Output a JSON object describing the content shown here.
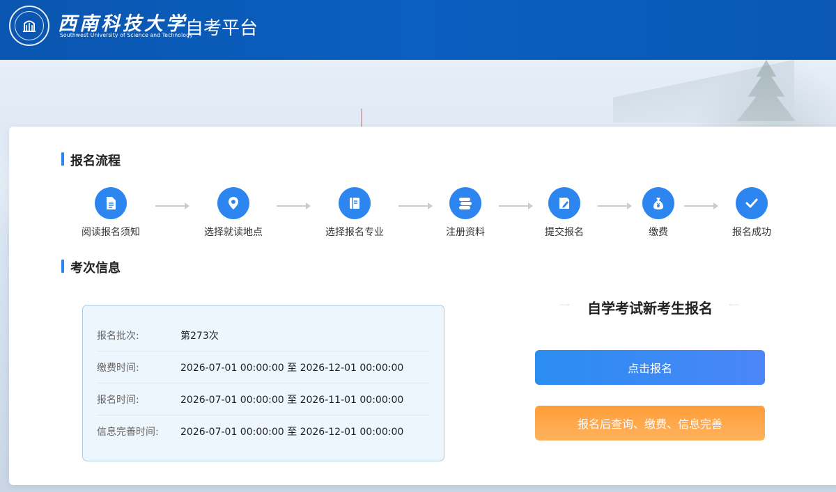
{
  "header": {
    "logo_cn": "西南科技大学",
    "logo_en": "Southwest University of Science and Technology",
    "platform_title": "自考平台"
  },
  "process": {
    "title": "报名流程",
    "steps": [
      {
        "label": "阅读报名须知",
        "icon": "document-icon"
      },
      {
        "label": "选择就读地点",
        "icon": "location-pin-icon"
      },
      {
        "label": "选择报名专业",
        "icon": "book-icon"
      },
      {
        "label": "注册资料",
        "icon": "register-stack-icon"
      },
      {
        "label": "提交报名",
        "icon": "edit-form-icon"
      },
      {
        "label": "缴费",
        "icon": "money-bag-icon"
      },
      {
        "label": "报名成功",
        "icon": "checkmark-icon"
      }
    ]
  },
  "exam_info": {
    "title": "考次信息",
    "rows": [
      {
        "key": "报名批次:",
        "value": "第273次"
      },
      {
        "key": "缴费时间:",
        "value": "2026-07-01 00:00:00 至 2026-12-01 00:00:00"
      },
      {
        "key": "报名时间:",
        "value": "2026-07-01 00:00:00 至 2026-11-01 00:00:00"
      },
      {
        "key": "信息完善时间:",
        "value": "2026-07-01 00:00:00 至 2026-12-01 00:00:00"
      }
    ]
  },
  "registration": {
    "title": "自学考试新考生报名",
    "primary_button": "点击报名",
    "secondary_button": "报名后查询、缴费、信息完善"
  },
  "colors": {
    "header_blue": "#0b5fc0",
    "accent_blue": "#2d86f0",
    "button_orange": "#ff9d38"
  }
}
